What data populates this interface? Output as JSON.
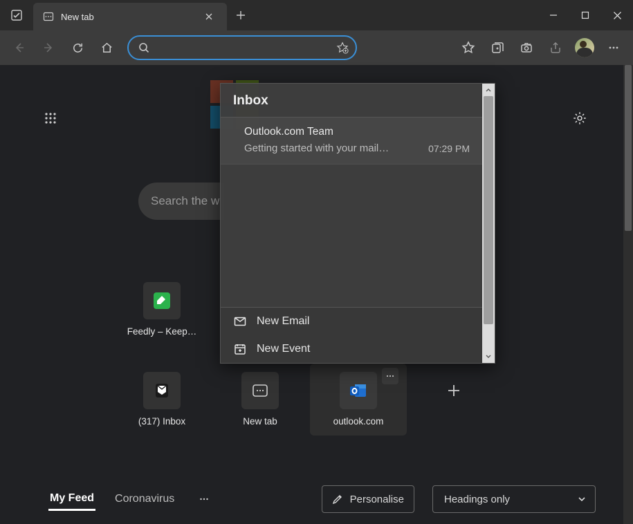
{
  "window": {
    "tab_title": "New tab"
  },
  "toolbar": {
    "address_value": ""
  },
  "newtab": {
    "search_placeholder": "Search the w",
    "quicklinks": {
      "feedly": "Feedly – Keep…",
      "inbox": "(317) Inbox",
      "newtab": "New tab",
      "outlook": "outlook.com"
    },
    "feed": {
      "tabs": [
        "My Feed",
        "Coronavirus"
      ],
      "personalise": "Personalise",
      "headings": "Headings only"
    }
  },
  "flyout": {
    "header": "Inbox",
    "items": [
      {
        "sender": "Outlook.com Team",
        "subject": "Getting started with your mail…",
        "time": "07:29 PM"
      }
    ],
    "actions": {
      "new_email": "New Email",
      "new_event": "New Event"
    }
  }
}
